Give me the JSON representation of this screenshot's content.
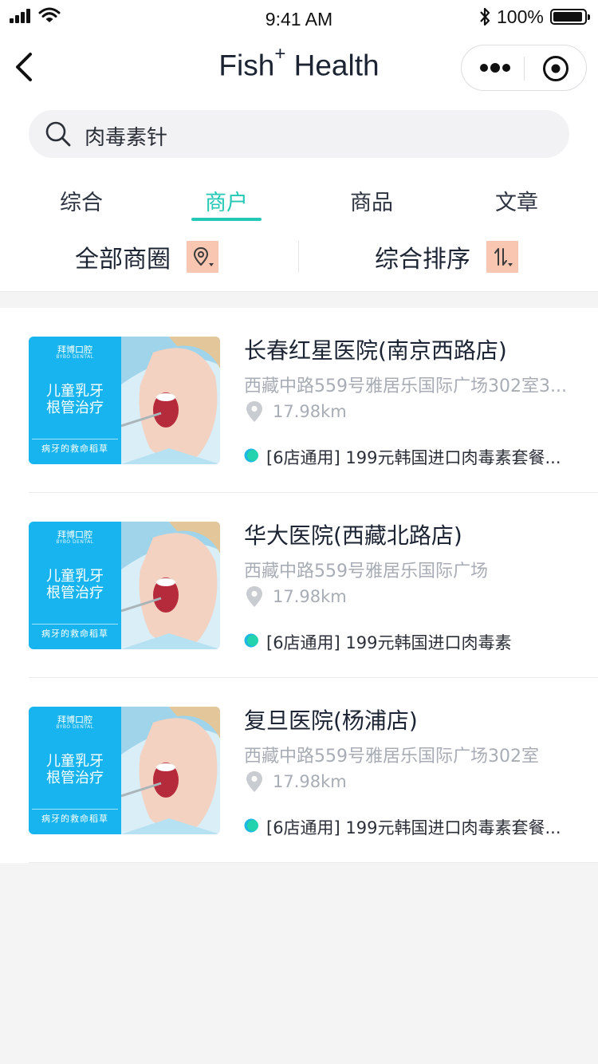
{
  "status_bar": {
    "time": "9:41 AM",
    "battery": "100%"
  },
  "nav": {
    "title_main": "Fish",
    "title_sup": "+",
    "title_rest": " Health"
  },
  "search": {
    "value": "肉毒素针"
  },
  "tabs": [
    {
      "label": "综合",
      "active": false
    },
    {
      "label": "商户",
      "active": true
    },
    {
      "label": "商品",
      "active": false
    },
    {
      "label": "文章",
      "active": false
    }
  ],
  "filters": {
    "area": "全部商圈",
    "sort": "综合排序"
  },
  "accent_color": "#23c9b4",
  "filter_badge_color": "#f9c6b1",
  "merchants": [
    {
      "name": "长春红星医院(南京西路店)",
      "address": "西藏中路559号雅居乐国际广场302室3...",
      "distance": "17.98km",
      "promo": "[6店通用] 199元韩国进口肉毒素套餐...",
      "thumb": {
        "brand": "拜博口腔",
        "brand_en": "BYBO DENTAL",
        "ad_line1": "儿童乳牙",
        "ad_line2": "根管治疗",
        "slogan": "病牙的救命稻草"
      }
    },
    {
      "name": "华大医院(西藏北路店)",
      "address": "西藏中路559号雅居乐国际广场",
      "distance": "17.98km",
      "promo": "[6店通用] 199元韩国进口肉毒素",
      "thumb": {
        "brand": "拜博口腔",
        "brand_en": "BYBO DENTAL",
        "ad_line1": "儿童乳牙",
        "ad_line2": "根管治疗",
        "slogan": "病牙的救命稻草"
      }
    },
    {
      "name": "复旦医院(杨浦店)",
      "address": "西藏中路559号雅居乐国际广场302室",
      "distance": "17.98km",
      "promo": "[6店通用] 199元韩国进口肉毒素套餐...",
      "thumb": {
        "brand": "拜博口腔",
        "brand_en": "BYBO DENTAL",
        "ad_line1": "儿童乳牙",
        "ad_line2": "根管治疗",
        "slogan": "病牙的救命稻草"
      }
    }
  ]
}
